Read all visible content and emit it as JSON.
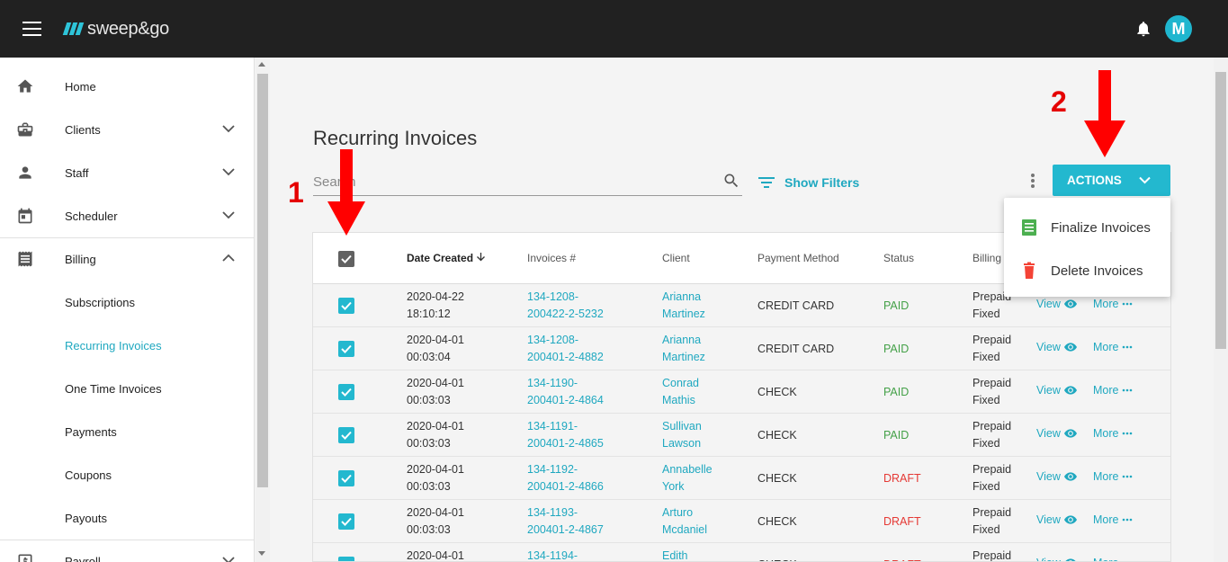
{
  "app": {
    "logo_text": "sweep&go",
    "avatar_initial": "M"
  },
  "sidebar": {
    "items": [
      {
        "label": "Home",
        "icon": "home-icon"
      },
      {
        "label": "Clients",
        "icon": "briefcase-icon"
      },
      {
        "label": "Staff",
        "icon": "person-icon"
      },
      {
        "label": "Scheduler",
        "icon": "calendar-icon"
      },
      {
        "label": "Billing",
        "icon": "receipt-icon"
      },
      {
        "label": "Subscriptions"
      },
      {
        "label": "Recurring Invoices",
        "active": true
      },
      {
        "label": "One Time Invoices"
      },
      {
        "label": "Payments"
      },
      {
        "label": "Coupons"
      },
      {
        "label": "Payouts"
      },
      {
        "label": "Payroll",
        "icon": "payroll-icon"
      }
    ]
  },
  "main": {
    "title": "Recurring Invoices",
    "search_placeholder": "Search",
    "show_filters": "Show Filters",
    "actions_label": "ACTIONS"
  },
  "menu": {
    "items": [
      {
        "label": "Finalize Invoices",
        "icon": "finalize-icon",
        "color": "#4caf50"
      },
      {
        "label": "Delete Invoices",
        "icon": "trash-icon",
        "color": "#f44336"
      }
    ]
  },
  "table": {
    "headers": {
      "date": "Date Created",
      "invoice": "Invoices #",
      "client": "Client",
      "payment": "Payment Method",
      "status": "Status",
      "billing": "Billing"
    },
    "view_label": "View",
    "more_label": "More",
    "rows": [
      {
        "date": "2020-04-22",
        "time": "18:10:12",
        "inv1": "134-1208-",
        "inv2": "200422-2-5232",
        "first": "Arianna",
        "last": "Martinez",
        "method": "CREDIT CARD",
        "status": "PAID",
        "bill1": "Prepaid",
        "bill2": "Fixed"
      },
      {
        "date": "2020-04-01",
        "time": "00:03:04",
        "inv1": "134-1208-",
        "inv2": "200401-2-4882",
        "first": "Arianna",
        "last": "Martinez",
        "method": "CREDIT CARD",
        "status": "PAID",
        "bill1": "Prepaid",
        "bill2": "Fixed"
      },
      {
        "date": "2020-04-01",
        "time": "00:03:03",
        "inv1": "134-1190-",
        "inv2": "200401-2-4864",
        "first": "Conrad",
        "last": "Mathis",
        "method": "CHECK",
        "status": "PAID",
        "bill1": "Prepaid",
        "bill2": "Fixed"
      },
      {
        "date": "2020-04-01",
        "time": "00:03:03",
        "inv1": "134-1191-",
        "inv2": "200401-2-4865",
        "first": "Sullivan",
        "last": "Lawson",
        "method": "CHECK",
        "status": "PAID",
        "bill1": "Prepaid",
        "bill2": "Fixed"
      },
      {
        "date": "2020-04-01",
        "time": "00:03:03",
        "inv1": "134-1192-",
        "inv2": "200401-2-4866",
        "first": "Annabelle",
        "last": "York",
        "method": "CHECK",
        "status": "DRAFT",
        "bill1": "Prepaid",
        "bill2": "Fixed"
      },
      {
        "date": "2020-04-01",
        "time": "00:03:03",
        "inv1": "134-1193-",
        "inv2": "200401-2-4867",
        "first": "Arturo",
        "last": "Mcdaniel",
        "method": "CHECK",
        "status": "DRAFT",
        "bill1": "Prepaid",
        "bill2": "Fixed"
      },
      {
        "date": "2020-04-01",
        "time": "",
        "inv1": "134-1194-",
        "inv2": "",
        "first": "Edith",
        "last": "",
        "method": "CHECK",
        "status": "DRAFT",
        "bill1": "Prepaid",
        "bill2": ""
      }
    ]
  },
  "annotations": {
    "step1": "1",
    "step2": "2"
  },
  "colors": {
    "accent": "#23b8cf",
    "paid": "#43a047",
    "draft": "#e53935",
    "topbar": "#212121"
  }
}
